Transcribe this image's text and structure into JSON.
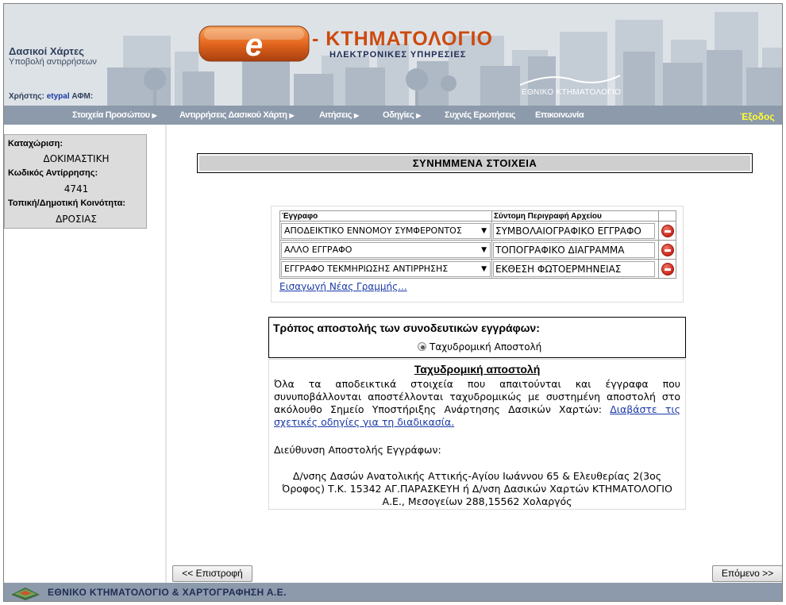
{
  "header": {
    "app_title": "Δασικοί Χάρτες",
    "app_subtitle": "Υποβολή αντιρρήσεων",
    "user_label": "Χρήστης:",
    "user_name": "etypal",
    "afm_label": "ΑΦΜ:",
    "logo_letter": "e",
    "logo_title": "- ΚΤΗΜΑΤΟΛΟΓΙΟ",
    "logo_subtitle": "ΗΛΕΚΤΡΟΝΙΚΕΣ ΥΠΗΡΕΣΙΕΣ",
    "org_logo_text": "ΕΘΝΙΚΟ ΚΤΗΜΑΤΟΛΟΓΙΟ"
  },
  "nav": {
    "items": [
      {
        "label": "Στοιχεία Προσώπου",
        "has_arrow": true
      },
      {
        "label": "Αντιρρήσεις Δασικού Χάρτη",
        "has_arrow": true
      },
      {
        "label": "Αιτήσεις",
        "has_arrow": true
      },
      {
        "label": "Οδηγίες",
        "has_arrow": true
      },
      {
        "label": "Συχνές Ερωτήσεις",
        "has_arrow": false
      },
      {
        "label": "Επικοινωνία",
        "has_arrow": false
      }
    ],
    "logout": "Έξοδος"
  },
  "info": {
    "registration_label": "Καταχώριση:",
    "registration_value": "ΔΟΚΙΜΑΣΤΙΚΗ",
    "objection_code_label": "Κωδικός Αντίρρησης:",
    "objection_code_value": "4741",
    "community_label": "Τοπική/Δημοτική Κοινότητα:",
    "community_value": "ΔΡΟΣΙΑΣ"
  },
  "section_title": "ΣΥΝΗΜΜΕΝΑ ΣΤΟΙΧΕΙΑ",
  "docs": {
    "col_document": "Έγγραφο",
    "col_description": "Σύντομη Περιγραφή Αρχείου",
    "rows": [
      {
        "document": "ΑΠΟΔΕΙΚΤΙΚΟ ΕΝΝΟΜΟΥ ΣΥΜΦΕΡΟΝΤΟΣ",
        "description": "ΣΥΜΒΟΛΑΙΟΓΡΑΦΙΚΟ ΕΓΓΡΑΦΟ"
      },
      {
        "document": "ΑΛΛΟ ΕΓΓΡΑΦΟ",
        "description": "ΤΟΠΟΓΡΑΦΙΚΟ ΔΙΑΓΡΑΜΜΑ"
      },
      {
        "document": "ΕΓΓΡΑΦΟ ΤΕΚΜΗΡΙΩΣΗΣ ΑΝΤΙΡΡΗΣΗΣ",
        "description": "ΕΚΘΕΣΗ ΦΩΤΟΕΡΜΗΝΕΙΑΣ"
      }
    ],
    "add_row": "Εισαγωγή Νέας Γραμμής..."
  },
  "send": {
    "title": "Τρόπος αποστολής των συνοδευτικών εγγράφων:",
    "option": "Ταχυδρομική Αποστολή"
  },
  "postal": {
    "title": "Ταχυδρομική αποστολή",
    "body": "Όλα τα αποδεικτικά στοιχεία που απαιτούνται και έγγραφα που συνυποβάλλονται αποστέλλονται ταχυδρομικώς με συστημένη αποστολή στο ακόλουθο Σημείο Υποστήριξης Ανάρτησης Δασικών Χαρτών:",
    "link": "Διαβάστε τις σχετικές οδηγίες για τη διαδικασία.",
    "address_label": "Διεύθυνση Αποστολής Εγγράφων:",
    "address": "Δ/νσης Δασών Ανατολικής Αττικής-Αγίου Ιωάννου 65 & Ελευθερίας 2(3ος Όροφος) Τ.Κ. 15342 ΑΓ.ΠΑΡΑΣΚΕΥΗ ή Δ/νση Δασικών Χαρτών ΚΤΗΜΑΤΟΛΟΓΙΟ Α.Ε., Μεσογείων 288,15562 Χολαργός"
  },
  "buttons": {
    "back": "<< Επιστροφή",
    "next": "Επόμενο >>"
  },
  "footer": {
    "text": "ΕΘΝΙΚΟ ΚΤΗΜΑΤΟΛΟΓΙΟ & ΧΑΡΤΟΓΡΑΦΗΣΗ Α.Ε."
  },
  "colors": {
    "nav_bg": "#8c9aab",
    "logout": "#ffff33",
    "link": "#1c3aa8",
    "logo_orange": "#cc4a0e",
    "delete_red": "#c8271a"
  }
}
